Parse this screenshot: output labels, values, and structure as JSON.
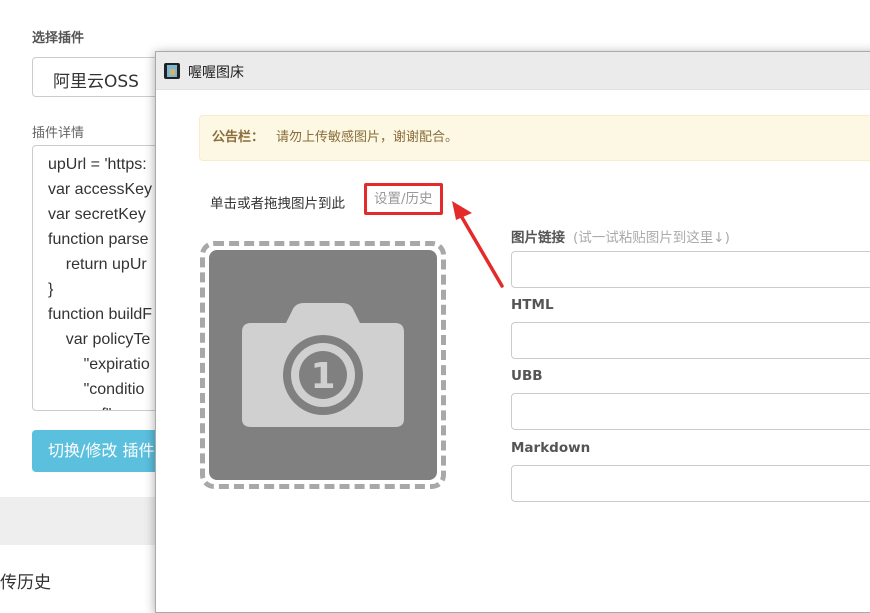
{
  "background": {
    "plugin_select_label": "选择插件",
    "plugin_select_value": "阿里云OSS",
    "plugin_detail_label": "插件详情",
    "code_lines": [
      "upUrl = 'https:",
      "var accessKey",
      "var secretKey",
      "function parse",
      "    return upUr",
      "}",
      "function buildF",
      "    var policyTe",
      "        \"expiratio",
      "        \"conditio",
      "            f\"  "
    ],
    "switch_button_label": "切换/修改 插件",
    "upload_history_label": "传历史"
  },
  "dialog": {
    "title": "喔喔图床",
    "notice_label": "公告栏：",
    "notice_text": "请勿上传敏感图片，谢谢配合。",
    "hint_text": "单击或者拖拽图片到此",
    "settings_link": "设置/历史",
    "dropzone_badge": "1",
    "fields": [
      {
        "label": "图片链接",
        "tip": "(试一试粘贴图片到这里↓)",
        "value": ""
      },
      {
        "label": "HTML",
        "tip": "",
        "value": ""
      },
      {
        "label": "UBB",
        "tip": "",
        "value": ""
      },
      {
        "label": "Markdown",
        "tip": "",
        "value": ""
      }
    ]
  },
  "colors": {
    "highlight_border": "#e32b2b",
    "button": "#5bc0de",
    "notice_bg": "#fcf8e3",
    "notice_text": "#8a6d3b",
    "dropzone": "#808080"
  }
}
